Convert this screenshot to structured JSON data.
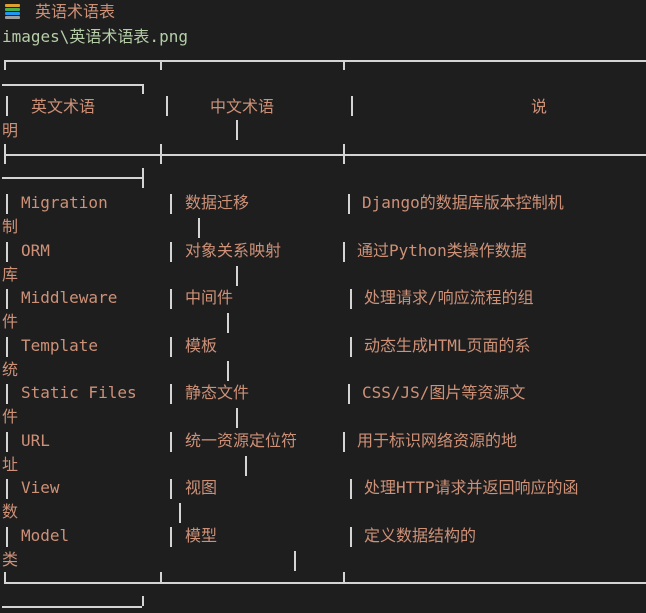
{
  "title": "英语术语表",
  "path": "images\\英语术语表.png",
  "header": {
    "col1": "英文术语",
    "col2": "中文术语",
    "col3": "说",
    "col3_wrap": "明"
  },
  "rows": [
    {
      "en": "Migration",
      "zh": "数据迁移",
      "desc": "Django的数据库版本控制机",
      "wrap": "制"
    },
    {
      "en": "ORM",
      "zh": "对象关系映射",
      "desc": "通过Python类操作数据",
      "wrap": "库"
    },
    {
      "en": "Middleware",
      "zh": "中间件",
      "desc": "处理请求/响应流程的组",
      "wrap": "件"
    },
    {
      "en": "Template",
      "zh": "模板",
      "desc": "动态生成HTML页面的系",
      "wrap": "统"
    },
    {
      "en": "Static Files",
      "zh": "静态文件",
      "desc": "CSS/JS/图片等资源文",
      "wrap": "件"
    },
    {
      "en": "URL",
      "zh": "统一资源定位符",
      "desc": "用于标识网络资源的地",
      "wrap": "址"
    },
    {
      "en": "View",
      "zh": "视图",
      "desc": "处理HTTP请求并返回响应的函",
      "wrap": "数"
    },
    {
      "en": "Model",
      "zh": "模型",
      "desc": "定义数据结构的",
      "wrap": "类"
    }
  ]
}
